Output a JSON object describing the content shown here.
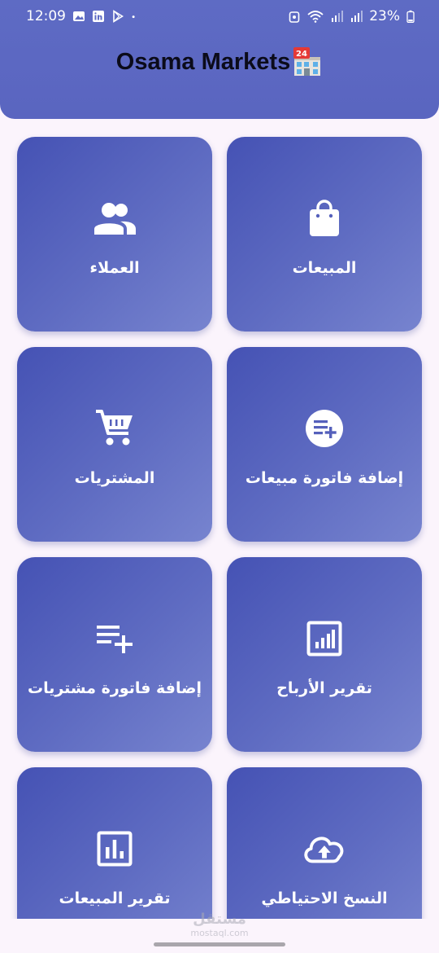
{
  "status_bar": {
    "time": "12:09",
    "battery": "23%",
    "left_icons": [
      "gallery-icon",
      "linkedin-icon",
      "play-store-icon",
      "dot-icon"
    ],
    "right_icons": [
      "vpn-icon",
      "wifi-icon",
      "signal-icon",
      "signal-icon-2",
      "battery-icon"
    ]
  },
  "app_bar": {
    "title": "Osama Markets",
    "title_icon": "store-24-icon",
    "title_icon_badge": "24"
  },
  "tiles": [
    {
      "label": "المبيعات",
      "icon": "shopping-bag-icon"
    },
    {
      "label": "العملاء",
      "icon": "people-icon"
    },
    {
      "label": "إضافة فاتورة مبيعات",
      "icon": "add-list-circle-icon"
    },
    {
      "label": "المشتريات",
      "icon": "shopping-cart-icon"
    },
    {
      "label": "تقرير الأرباح",
      "icon": "report-chart-icon"
    },
    {
      "label": "إضافة فاتورة مشتريات",
      "icon": "playlist-add-icon"
    },
    {
      "label": "النسخ الاحتياطي",
      "icon": "cloud-upload-icon"
    },
    {
      "label": "تقرير المبيعات",
      "icon": "bar-chart-icon"
    }
  ],
  "watermark": {
    "arabic": "مستقل",
    "latin": "mostaql.com"
  },
  "colors": {
    "app_bar": "#5e6bc4",
    "tile_start": "#4552b4",
    "tile_end": "#7784cf",
    "background": "#fbf4fc",
    "title_text": "#0b0b1a"
  }
}
